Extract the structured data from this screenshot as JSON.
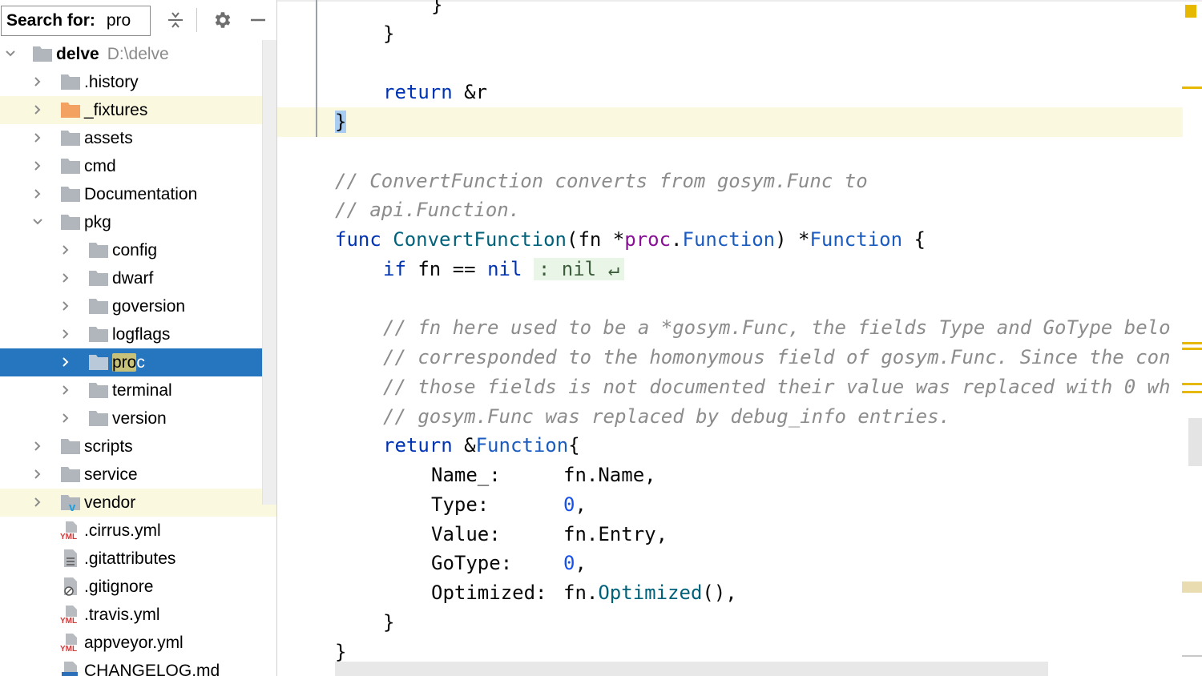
{
  "project_panel": {
    "search": {
      "label": "Search for:",
      "value": "pro"
    },
    "toolbar": {
      "collapse_icon": "collapse-all-icon",
      "settings_icon": "gear-icon",
      "hide_icon": "minimize-icon"
    },
    "tree": {
      "root": {
        "name": "delve",
        "path": "D:\\delve"
      },
      "items": [
        {
          "label": ".history",
          "kind": "folder"
        },
        {
          "label": "_fixtures",
          "kind": "folder-orange"
        },
        {
          "label": "assets",
          "kind": "folder"
        },
        {
          "label": "cmd",
          "kind": "folder"
        },
        {
          "label": "Documentation",
          "kind": "folder"
        },
        {
          "label": "pkg",
          "kind": "folder"
        },
        {
          "label": "config",
          "kind": "folder"
        },
        {
          "label": "dwarf",
          "kind": "folder"
        },
        {
          "label": "goversion",
          "kind": "folder"
        },
        {
          "label": "logflags",
          "kind": "folder"
        },
        {
          "label_match": "pro",
          "label_rest": "c",
          "kind": "folder"
        },
        {
          "label": "terminal",
          "kind": "folder"
        },
        {
          "label": "version",
          "kind": "folder"
        },
        {
          "label": "scripts",
          "kind": "folder"
        },
        {
          "label": "service",
          "kind": "folder"
        },
        {
          "label": "vendor",
          "kind": "folder-vendor"
        },
        {
          "label": ".cirrus.yml",
          "kind": "file-yml"
        },
        {
          "label": ".gitattributes",
          "kind": "file-text"
        },
        {
          "label": ".gitignore",
          "kind": "file-ignore"
        },
        {
          "label": ".travis.yml",
          "kind": "file-yml"
        },
        {
          "label": "appveyor.yml",
          "kind": "file-yml"
        },
        {
          "label": "CHANGELOG.md",
          "kind": "file-md"
        }
      ]
    }
  },
  "editor": {
    "lines": {
      "l0": "}",
      "l1": "}",
      "l2_kw": "return",
      "l2_rest": " &r",
      "l3": "}",
      "c1": "// ConvertFunction converts from gosym.Func to",
      "c2": "// api.Function.",
      "f_kw": "func",
      "f_name": "ConvertFunction",
      "f_p1": "(fn *",
      "f_pkg": "proc",
      "f_dot": ".",
      "f_type": "Function",
      "f_p2": ") *",
      "f_rtype": "Function",
      "f_p3": " {",
      "if_kw": "if",
      "if_mid": " fn == ",
      "if_nil": "nil",
      "if_inlay": ": nil ↵",
      "c3": "// fn here used to be a *gosym.Func, the fields Type and GoType belo",
      "c4": "// corresponded to the homonymous field of gosym.Func. Since the con",
      "c5": "// those fields is not documented their value was replaced with 0 wh",
      "c6": "// gosym.Func was replaced by debug_info entries.",
      "r_kw": "return",
      "r_amp": " &",
      "r_type": "Function",
      "r_brace": "{",
      "name_key": "Name_:",
      "name_val": "fn.Name,",
      "type_key": "Type:",
      "type_num": "0",
      "type_comma": ",",
      "value_key": "Value:",
      "value_val": "fn.Entry,",
      "gotype_key": "GoType:",
      "gotype_num": "0",
      "gotype_comma": ",",
      "opt_key": "Optimized:",
      "opt_recv": "fn.",
      "opt_method": "Optimized",
      "opt_tail": "(),",
      "close_inner": "}",
      "close_outer": "}"
    }
  },
  "colors": {
    "selection": "#2675bf",
    "keyword": "#0033b3",
    "function_decl": "#00627a",
    "type": "#1a5bbf",
    "package": "#871094",
    "number": "#1750eb",
    "comment": "#8c8c8c",
    "highlight_row": "#fbf8e0",
    "stripe_warning": "#e6b800"
  }
}
